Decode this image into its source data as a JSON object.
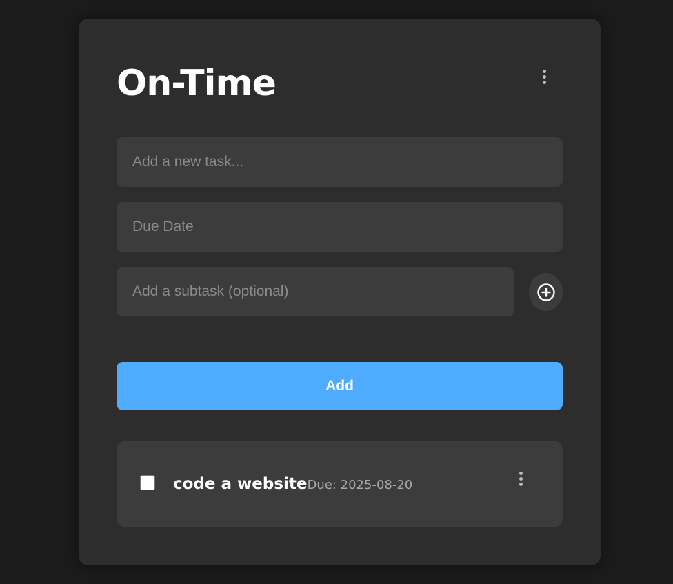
{
  "app": {
    "title": "On-Time"
  },
  "form": {
    "task_placeholder": "Add a new task...",
    "due_date_placeholder": "Due Date",
    "subtask_placeholder": "Add a subtask (optional)",
    "add_subtask_icon": "plus-circle-icon",
    "add_button_label": "Add"
  },
  "tasks": [
    {
      "name": "code a website",
      "due_label": "Due: 2025-08-20",
      "completed": false
    }
  ],
  "colors": {
    "background": "#1b1b1b",
    "card": "#2d2d2d",
    "input": "#3c3c3c",
    "accent": "#4eabfd"
  },
  "icons": {
    "header_menu": "more-vertical-icon",
    "task_menu": "more-vertical-icon"
  }
}
